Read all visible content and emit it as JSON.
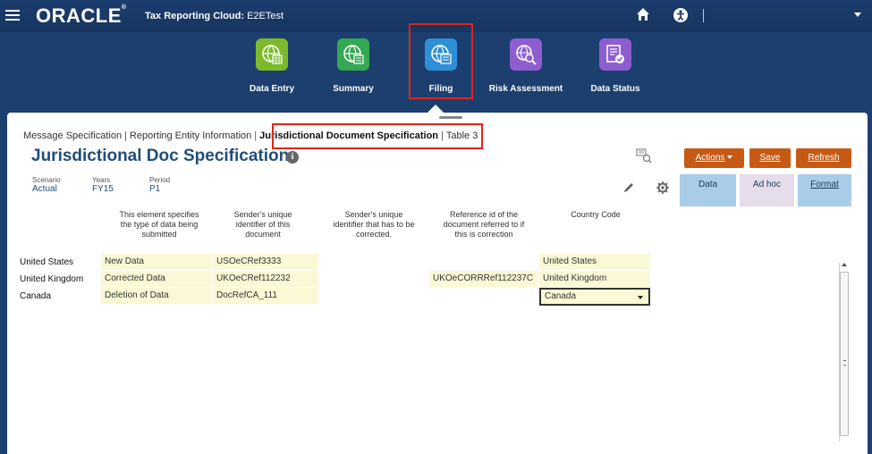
{
  "topbar": {
    "logo": "ORACLE",
    "logo_mark": "®",
    "app_title": "Tax Reporting Cloud:",
    "environment": "E2ETest"
  },
  "nav": [
    {
      "label": "Data Entry",
      "color": "#7cba2b"
    },
    {
      "label": "Summary",
      "color": "#34a853"
    },
    {
      "label": "Filing",
      "color": "#2f8fd6"
    },
    {
      "label": "Risk Assessment",
      "color": "#8e5ed0"
    },
    {
      "label": "Data Status",
      "color": "#8e5ed0"
    }
  ],
  "breadcrumb": {
    "items": [
      "Message Specification",
      "Reporting Entity Information",
      "Jurisdictional Document Specification",
      "Table 3"
    ],
    "separator": "|"
  },
  "page": {
    "title": "Jurisdictional Doc Specification",
    "info_glyph": "i"
  },
  "pov": {
    "scenario_label": "Scenario",
    "scenario_value": "Actual",
    "years_label": "Years",
    "years_value": "FY15",
    "period_label": "Period",
    "period_value": "P1"
  },
  "toolbar": {
    "actions": "Actions",
    "save": "Save",
    "refresh": "Refresh",
    "data": "Data",
    "adhoc": "Ad hoc",
    "format": "Format"
  },
  "grid": {
    "columns": [
      [
        "This element specifies",
        "the type of data being",
        "submitted"
      ],
      [
        "Sender's unique",
        "identifier of this",
        "document"
      ],
      [
        "Sender's unique",
        "identifier that has to be",
        "corrected."
      ],
      [
        "Reference id of the",
        "document referred to if",
        "this is correction"
      ],
      [
        "Country Code",
        "",
        ""
      ]
    ],
    "rows": [
      {
        "header": "United States",
        "cells": [
          "New Data",
          "USOeCRef3333",
          "",
          "",
          "United States"
        ]
      },
      {
        "header": "United Kingdom",
        "cells": [
          "Corrected Data",
          "UKOeCRef112232",
          "",
          "UKOeCORRRef112237C",
          "United Kingdom"
        ]
      },
      {
        "header": "Canada",
        "cells": [
          "Deletion of Data",
          "DocRefCA_111",
          "",
          "",
          "Canada"
        ]
      }
    ]
  },
  "colors": {
    "brand_navy": "#1d3f70",
    "action_orange": "#c65a15",
    "highlight_red": "#e2231a",
    "cell_yellow": "#fbf8d5",
    "title_blue": "#1f4e79"
  }
}
